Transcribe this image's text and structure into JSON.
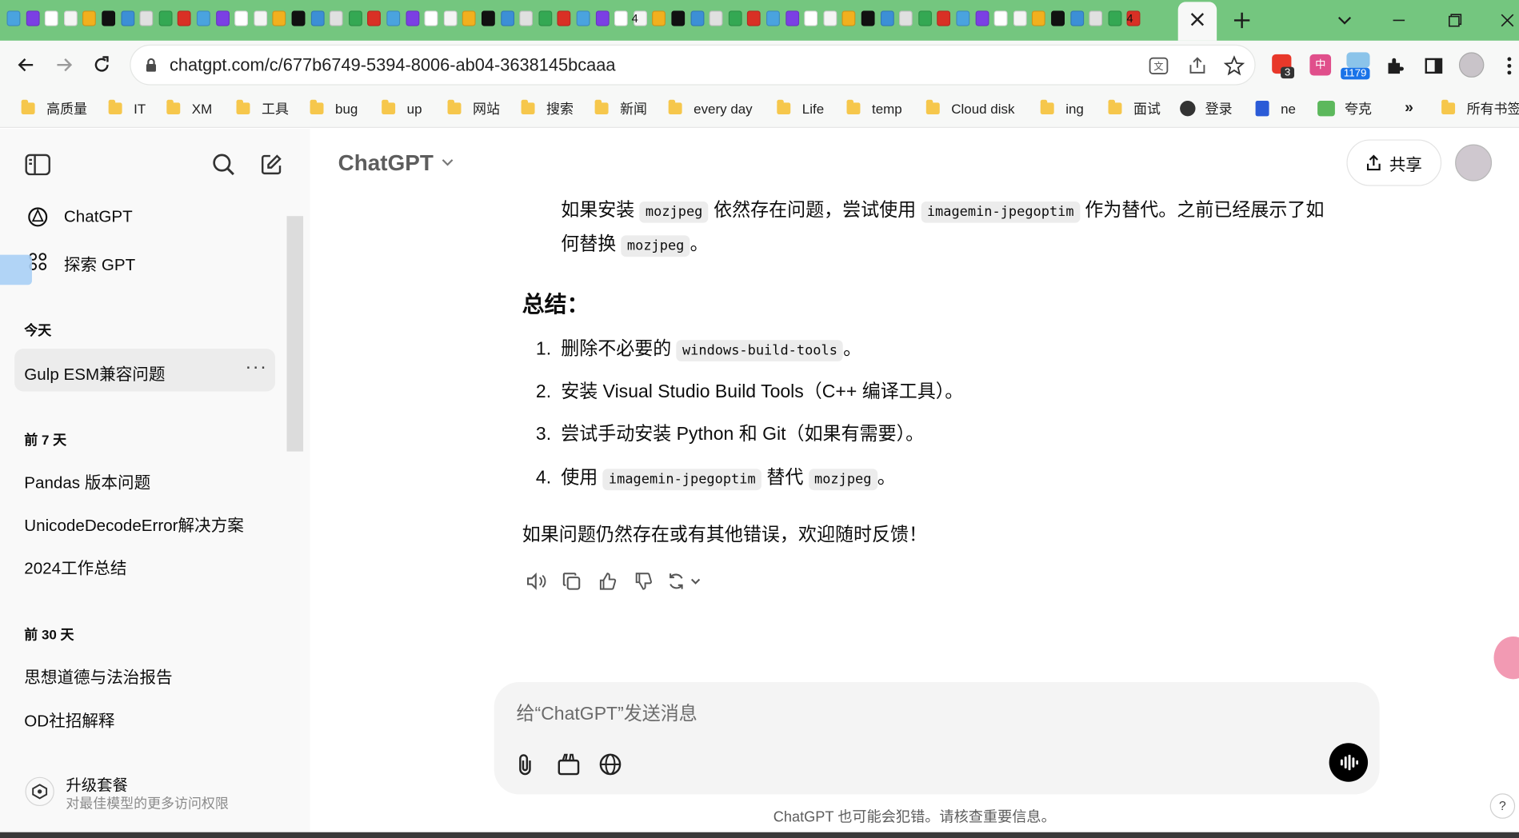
{
  "browser": {
    "url": "chatgpt.com/c/677b6749-5394-8006-ab04-3638145bcaaa",
    "ext_badges": {
      "mail": "3",
      "count": "1179"
    },
    "bookmarks": [
      "高质量",
      "IT",
      "XM",
      "工具",
      "bug",
      "up",
      "网站",
      "搜索",
      "新闻",
      "every day",
      "Life",
      "temp",
      "Cloud disk",
      "ing",
      "面试",
      "登录",
      "ne",
      "夸克"
    ],
    "all_bookmarks": "所有书签",
    "tab_badges": [
      "4",
      "4"
    ]
  },
  "sidebar": {
    "nav": {
      "chatgpt": "ChatGPT",
      "explore": "探索 GPT"
    },
    "sections": [
      {
        "title": "今天",
        "items": [
          "Gulp ESM兼容问题"
        ]
      },
      {
        "title": "前 7 天",
        "items": [
          "Pandas 版本问题",
          "UnicodeDecodeError解决方案",
          "2024工作总结"
        ]
      },
      {
        "title": "前 30 天",
        "items": [
          "思想道德与法治报告",
          "OD社招解释"
        ]
      }
    ],
    "upgrade": {
      "title": "升级套餐",
      "subtitle": "对最佳模型的更多访问权限"
    }
  },
  "header": {
    "model": "ChatGPT",
    "share": "共享"
  },
  "message": {
    "intro": {
      "t1": "如果安装 ",
      "c1": "mozjpeg",
      "t2": " 依然存在问题，尝试使用 ",
      "c2": "imagemin-jpegoptim",
      "t3": " 作为替代。之前已经展示了如",
      "t4": "何替换 ",
      "c3": "mozjpeg",
      "t5": "。"
    },
    "heading": "总结：",
    "list": {
      "n1": "1.",
      "i1a": "删除不必要的 ",
      "i1c": "windows-build-tools",
      "i1b": "。",
      "n2": "2.",
      "i2": "安装 Visual Studio Build Tools（C++ 编译工具）。",
      "n3": "3.",
      "i3": "尝试手动安装 Python 和 Git（如果有需要）。",
      "n4": "4.",
      "i4a": "使用 ",
      "i4c1": "imagemin-jpegoptim",
      "i4b": " 替代 ",
      "i4c2": "mozjpeg",
      "i4d": "。"
    },
    "closing": "如果问题仍然存在或有其他错误，欢迎随时反馈！"
  },
  "composer": {
    "placeholder": "给“ChatGPT”发送消息"
  },
  "footer": {
    "disclaimer": "ChatGPT 也可能会犯错。请核查重要信息。",
    "help": "?"
  },
  "colors": {
    "tabstrip": "#74c67f",
    "sidebar": "#f9f9f9",
    "code_bg": "#ececec",
    "accent": "#0d0d0d"
  }
}
